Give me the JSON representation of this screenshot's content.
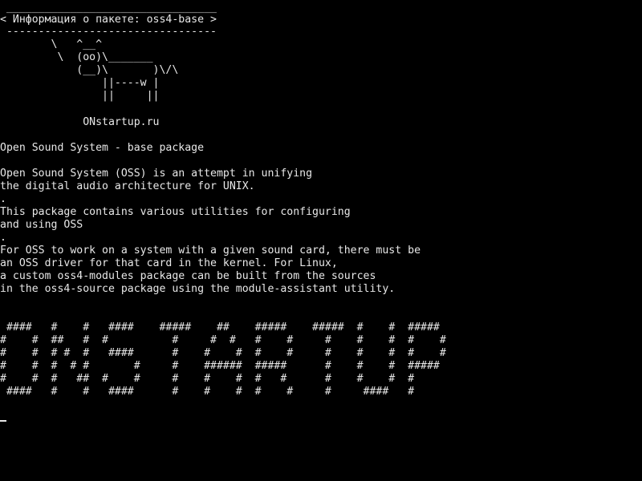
{
  "terminal": {
    "cowsay": {
      "border_top": " _________________________________",
      "title": "< Информация о пакете: oss4-base >",
      "border_bottom": " ---------------------------------",
      "cow_line1": "        \\   ^__^",
      "cow_line2": "         \\  (oo)\\_______",
      "cow_line3": "            (__)\\       )\\/\\",
      "cow_line4": "                ||----w |",
      "cow_line5": "                ||     ||"
    },
    "site": "             ONstartup.ru",
    "summary": "Open Sound System - base package",
    "description": [
      "Open Sound System (OSS) is an attempt in unifying",
      "the digital audio architecture for UNIX.",
      ".",
      "This package contains various utilities for configuring",
      "and using OSS",
      ".",
      "For OSS to work on a system with a given sound card, there must be",
      "an OSS driver for that card in the kernel. For Linux,",
      "a custom oss4-modules package can be built from the sources",
      "in the oss4-source package using the module-assistant utility."
    ],
    "banner": [
      " ####   #    #   ####    #####    ##    #####    #####  #    #  #####",
      "#    #  ##   #  #          #     #  #   #    #     #    #    #  #    #",
      "#    #  # #  #   ####      #    #    #  #    #     #    #    #  #    #",
      "#    #  #  # #       #     #    ######  #####      #    #    #  #####",
      "#    #  #   ##  #    #     #    #    #  #   #      #    #    #  #",
      " ####   #    #   ####      #    #    #  #    #     #     ####   #"
    ]
  }
}
